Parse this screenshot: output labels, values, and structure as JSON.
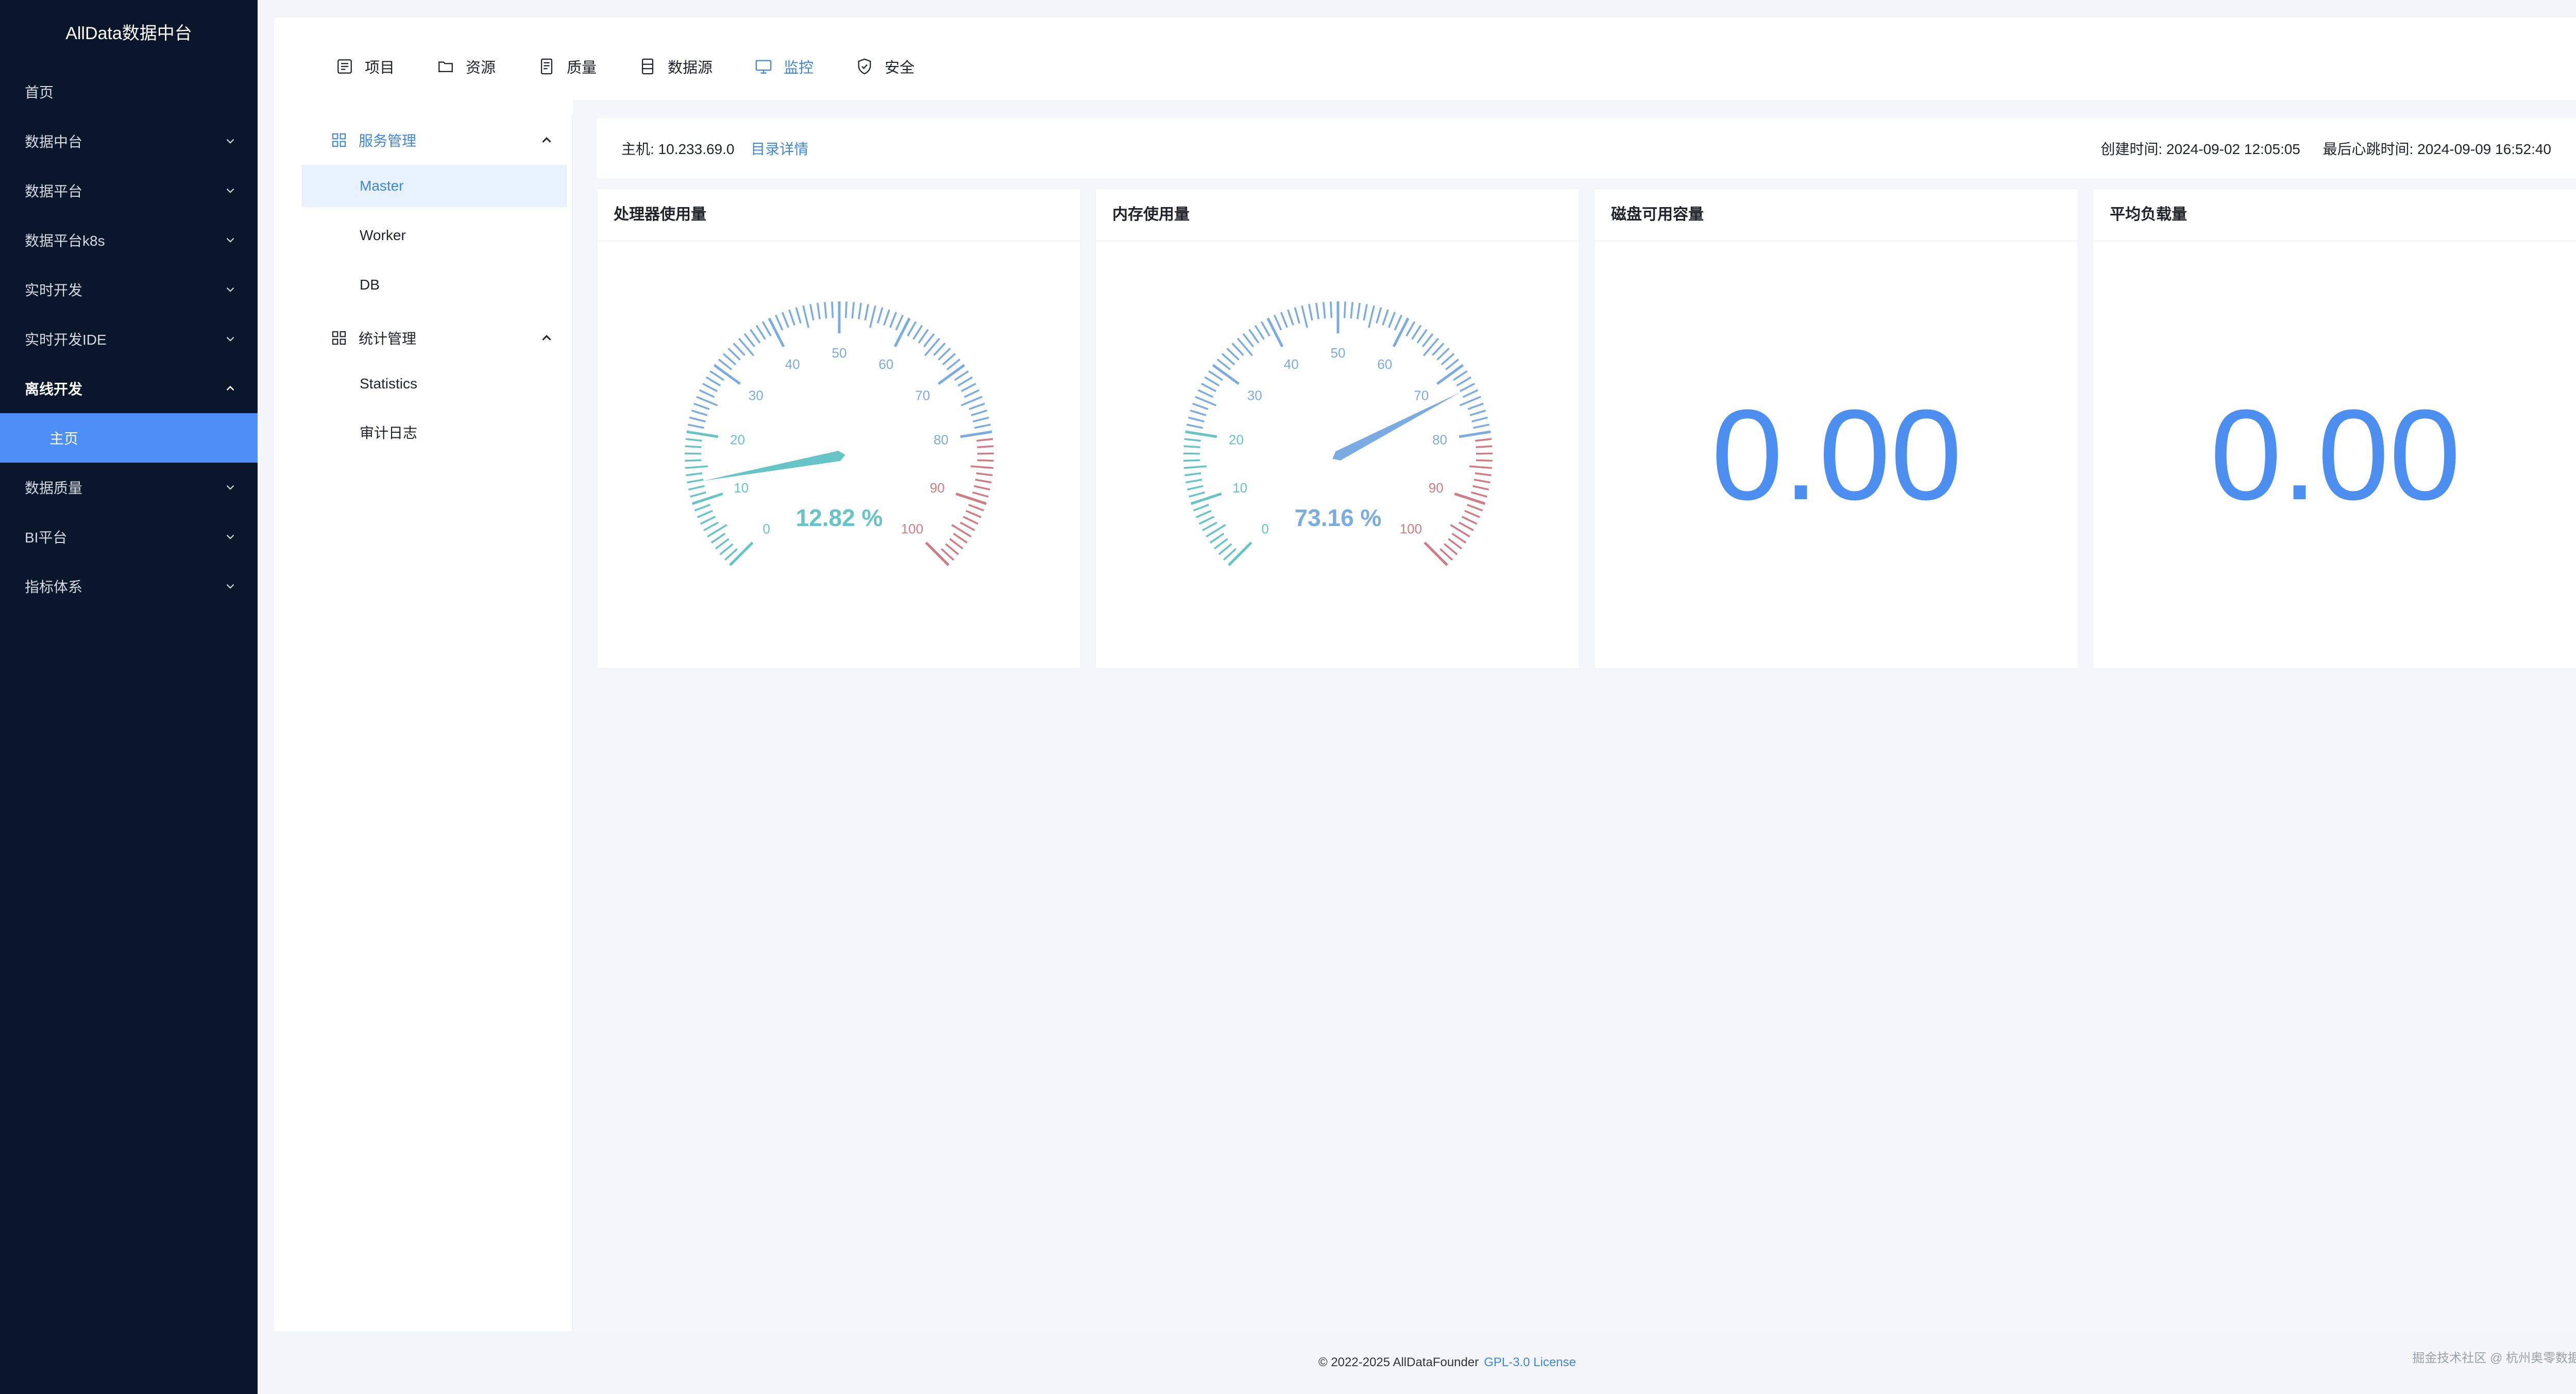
{
  "brand": "AllData数据中台",
  "sidebar": {
    "items": [
      {
        "label": "首页",
        "chevron": ""
      },
      {
        "label": "数据中台",
        "chevron": "down"
      },
      {
        "label": "数据平台",
        "chevron": "down"
      },
      {
        "label": "数据平台k8s",
        "chevron": "down"
      },
      {
        "label": "实时开发",
        "chevron": "down"
      },
      {
        "label": "实时开发IDE",
        "chevron": "down"
      },
      {
        "label": "离线开发",
        "chevron": "up"
      },
      {
        "label": "主页",
        "chevron": ""
      },
      {
        "label": "数据质量",
        "chevron": "down"
      },
      {
        "label": "BI平台",
        "chevron": "down"
      },
      {
        "label": "指标体系",
        "chevron": "down"
      }
    ]
  },
  "tabs": [
    {
      "label": "项目",
      "icon": "list-icon"
    },
    {
      "label": "资源",
      "icon": "folder-icon"
    },
    {
      "label": "质量",
      "icon": "document-icon"
    },
    {
      "label": "数据源",
      "icon": "database-icon"
    },
    {
      "label": "监控",
      "icon": "monitor-icon"
    },
    {
      "label": "安全",
      "icon": "shield-icon"
    }
  ],
  "submenu": {
    "groups": [
      {
        "title": "服务管理",
        "items": [
          "Master",
          "Worker",
          "DB"
        ]
      },
      {
        "title": "统计管理",
        "items": [
          "Statistics",
          "审计日志"
        ]
      }
    ]
  },
  "infobar": {
    "host_label": "主机: 10.233.69.0",
    "detail_link": "目录详情",
    "created": "创建时间: 2024-09-02 12:05:05",
    "heartbeat": "最后心跳时间: 2024-09-09 16:52:40"
  },
  "panels": {
    "cpu": {
      "title": "处理器使用量",
      "value": 12.82,
      "display": "12.82 %"
    },
    "memory": {
      "title": "内存使用量",
      "value": 73.16,
      "display": "73.16 %"
    },
    "disk": {
      "title": "磁盘可用容量",
      "value": "0.00"
    },
    "load": {
      "title": "平均负载量",
      "value": "0.00"
    }
  },
  "gauge_ticks": [
    "0",
    "10",
    "20",
    "30",
    "40",
    "50",
    "60",
    "70",
    "80",
    "90",
    "100"
  ],
  "colors": {
    "sidebar": "#0a1629",
    "accent": "#3f87dc",
    "teal": "#67c4c6",
    "blue": "#7aabe3",
    "red": "#d27b84"
  },
  "footer": {
    "copyright": "© 2022-2025 AllDataFounder",
    "license": "GPL-3.0 License"
  },
  "watermark": "掘金技术社区 @ 杭州奥零数据科技"
}
